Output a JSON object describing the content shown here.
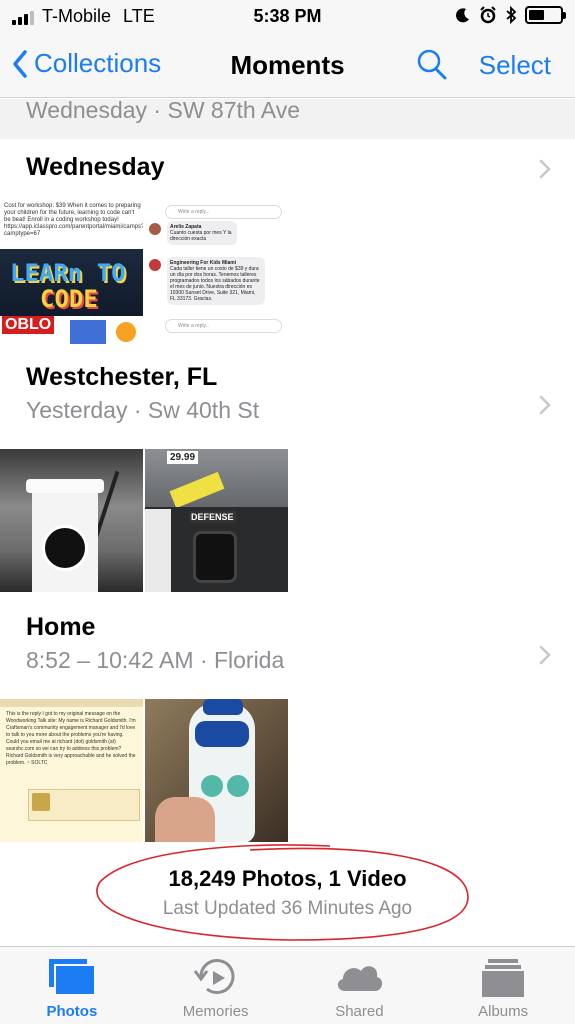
{
  "status_bar": {
    "carrier": "T-Mobile",
    "network": "LTE",
    "time": "5:38 PM",
    "battery_level": 0.5
  },
  "nav": {
    "back_label": "Collections",
    "title": "Moments",
    "search_icon": "search-icon",
    "select_label": "Select"
  },
  "moments": {
    "partial": {
      "subtitle": "Wednesday  ·  SW 87th Ave"
    },
    "items": [
      {
        "title": "Wednesday",
        "subtitle": "",
        "thumb_text_1": "Cost for workshop: $39 When it comes to preparing your children for the future, learning to code can't be beat! Enroll in a coding workshop today! https://app.iclasspro.com/parentportal/miami/camps?camptype=67",
        "thumb_word_1": "LEARn TO",
        "thumb_word_2": "CODE",
        "thumb_rb": "OBLO",
        "chat_reply_1": "Write a reply...",
        "chat_name_1": "Arelis Zapata",
        "chat_msg_1": "Cuanto cuesta por mes Y la dirección exacta",
        "chat_name_2": "Engineering For Kids Miami",
        "chat_msg_2": "Cada taller tiene un costo de $39 y dura un día por dos horas. Tenemos talleres programados todos los sábados durante el mes de junio. Nuestra dirección es 10300 Sunset Drive, Suite 321, Miami, FL 33173. Gracias.",
        "chat_reply_2": "Write a reply..."
      },
      {
        "title": "Westchester, FL",
        "subtitle": "Yesterday  ·  Sw 40th St",
        "price_tag": "29.99",
        "defense_label": "DEFENSE"
      },
      {
        "title": "Home",
        "subtitle": "8:52 – 10:42 AM  ·  Florida",
        "forum_text": "This is the reply I got to my original message on the Woodworking Talk site: My name is Richard Goldsmith. I'm Craftsman's community engagement manager and I'd love to talk to you more about the problems you're having. Could you email me at richard (dot) goldsmith (at) searshc.com so we can try to address this problem? Richard Goldsmith is very approachable and he solved the problem. ~ SOLTC"
      }
    ]
  },
  "summary": {
    "count": "18,249 Photos, 1 Video",
    "updated": "Last Updated 36 Minutes Ago",
    "annotation_color": "#d9262c"
  },
  "tabs": [
    {
      "label": "Photos",
      "icon": "photos-icon",
      "active": true
    },
    {
      "label": "Memories",
      "icon": "memories-icon",
      "active": false
    },
    {
      "label": "Shared",
      "icon": "shared-cloud-icon",
      "active": false
    },
    {
      "label": "Albums",
      "icon": "albums-icon",
      "active": false
    }
  ],
  "colors": {
    "accent": "#1b7cf3",
    "secondary_text": "#8e8e93"
  }
}
